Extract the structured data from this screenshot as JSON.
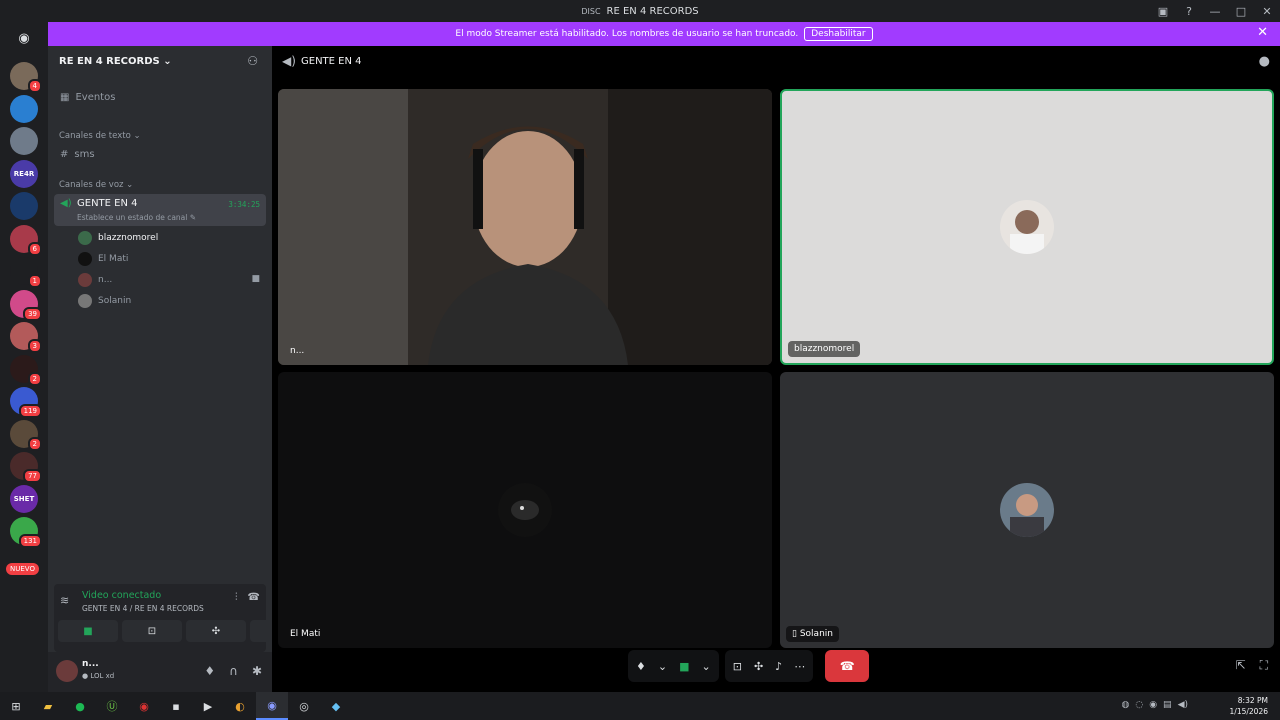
{
  "window": {
    "title": "RE EN 4 RECORDS",
    "logo": "DISC"
  },
  "banner": {
    "text": "El modo Streamer está habilitado. Los nombres de usuario se han truncado.",
    "button": "Deshabilitar"
  },
  "rail": {
    "servers": [
      {
        "badge": "4",
        "color": "#7a6a5a"
      },
      {
        "badge": "",
        "color": "#2a7fd1"
      },
      {
        "badge": "",
        "color": "#6f7b8a"
      },
      {
        "badge": "",
        "color": "#4a3ba8",
        "label": "RE4R"
      },
      {
        "badge": "",
        "color": "#1a3a6a"
      },
      {
        "badge": "6",
        "color": "#a83a4a"
      },
      {
        "badge": "1",
        "color": "#1e1f22"
      },
      {
        "badge": "39",
        "color": "#d14a8a"
      },
      {
        "badge": "3",
        "color": "#b35a5a"
      },
      {
        "badge": "2",
        "color": "#2b1a1a"
      },
      {
        "badge": "119",
        "color": "#3a5ad1"
      },
      {
        "badge": "2",
        "color": "#5a4a3a"
      },
      {
        "badge": "77",
        "color": "#4a2a2a"
      },
      {
        "badge": "",
        "color": "#6a2aa8",
        "label": "SHET"
      },
      {
        "badge": "131",
        "color": "#3aa84a"
      }
    ],
    "new_label": "NUEVO"
  },
  "sidebar": {
    "server_name": "RE EN 4 RECORDS",
    "events": "Eventos",
    "text_category": "Canales de texto",
    "text_channel": "sms",
    "voice_category": "Canales de voz",
    "voice_channel": {
      "name": "GENTE EN 4",
      "status": "Establece un estado de canal",
      "time": "3:34:25"
    },
    "voice_users": [
      "blazznomorel",
      "El Mati",
      "n...",
      "Solanin"
    ]
  },
  "connection": {
    "title": "Video conectado",
    "subtitle": "GENTE EN 4 / RE EN 4 RECORDS"
  },
  "user": {
    "name": "n...",
    "status": "LOL xd"
  },
  "channel_header": {
    "name": "GENTE EN 4"
  },
  "tiles": [
    {
      "label": "n..."
    },
    {
      "label": "blazznomorel"
    },
    {
      "label": "El Mati"
    },
    {
      "label": "Solanin"
    }
  ],
  "taskbar": {
    "time": "8:32 PM",
    "date": "1/15/2026"
  }
}
